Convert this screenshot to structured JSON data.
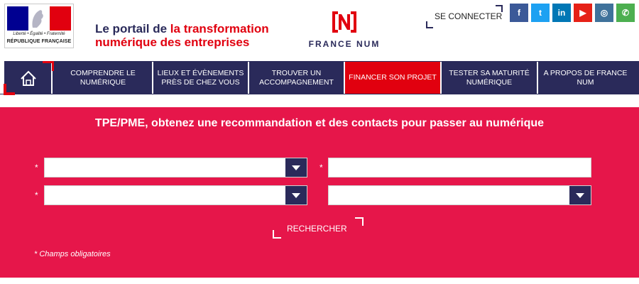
{
  "header": {
    "rf_logo": {
      "motto": "Liberté • Égalité • Fraternité",
      "name": "RÉPUBLIQUE FRANÇAISE",
      "colors": [
        "#000091",
        "#ffffff",
        "#e1000f"
      ]
    },
    "tagline_part1": "Le portail de ",
    "tagline_part2": "la transformation numérique des entreprises",
    "brand": {
      "mark": "[N]",
      "name": "FRANCE NUM"
    },
    "connect_label": "SE CONNECTER",
    "socials": [
      {
        "icon": "facebook-icon",
        "glyph": "f",
        "color": "#3b5998"
      },
      {
        "icon": "twitter-icon",
        "glyph": "t",
        "color": "#1da1f2"
      },
      {
        "icon": "linkedin-icon",
        "glyph": "in",
        "color": "#0077b5"
      },
      {
        "icon": "youtube-icon",
        "glyph": "▶",
        "color": "#e62117"
      },
      {
        "icon": "instagram-icon",
        "glyph": "◎",
        "color": "#3f729b"
      },
      {
        "icon": "whatsapp-icon",
        "glyph": "✆",
        "color": "#4caf50"
      }
    ]
  },
  "nav": {
    "home_icon": "home-icon",
    "items": [
      {
        "label": "COMPRENDRE LE NUMÉRIQUE",
        "active": false
      },
      {
        "label": "LIEUX ET ÉVÈNEMENTS PRÈS DE CHEZ VOUS",
        "active": false
      },
      {
        "label": "TROUVER UN ACCOMPAGNEMENT",
        "active": false
      },
      {
        "label": "FINANCER SON PROJET",
        "active": true
      },
      {
        "label": "TESTER SA MATURITÉ NUMÉRIQUE",
        "active": false
      },
      {
        "label": "A PROPOS DE FRANCE NUM",
        "active": false
      }
    ]
  },
  "form": {
    "title": "TPE/PME, obtenez une recommandation et des contacts pour passer au numérique",
    "required_mark": "*",
    "select1_value": "",
    "input1_value": "",
    "select2_value": "",
    "select3_value": "",
    "search_label": "RECHERCHER",
    "required_note": "* Champs obligatoires"
  },
  "colors": {
    "navy": "#2a2a5a",
    "red": "#e1000f",
    "panel": "#e6164a"
  }
}
